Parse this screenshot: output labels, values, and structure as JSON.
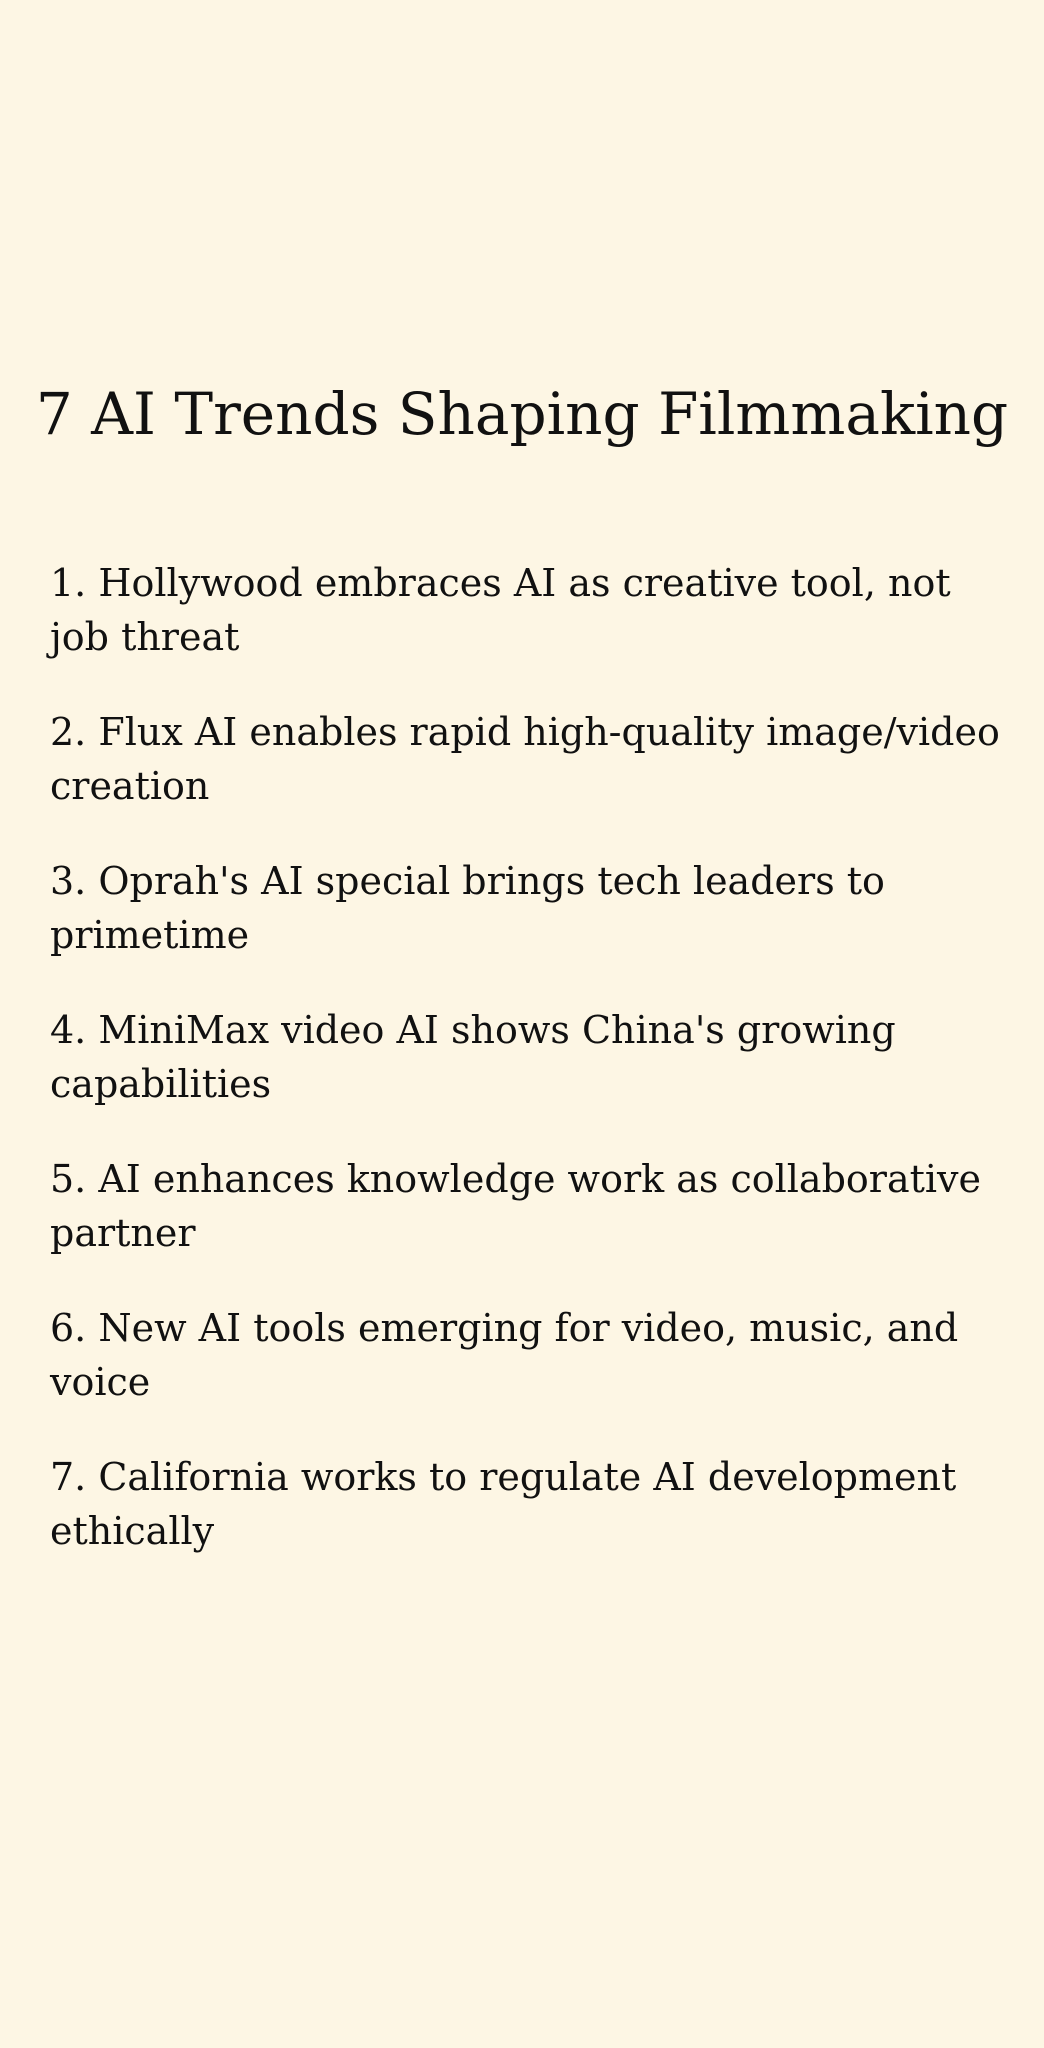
{
  "page": {
    "title": "7 AI Trends Shaping Filmmaking",
    "background": "#fdf6e4",
    "text_color": "#111111"
  },
  "trends": [
    {
      "text": "1. Hollywood embraces AI as creative tool, not job threat"
    },
    {
      "text": "2. Flux AI enables rapid high-quality image/video creation"
    },
    {
      "text": "3. Oprah's AI special brings tech leaders to primetime"
    },
    {
      "text": "4. MiniMax video AI shows China's growing capabilities"
    },
    {
      "text": "5. AI enhances knowledge work as collaborative partner"
    },
    {
      "text": "6. New AI tools emerging for video, music, and voice"
    },
    {
      "text": "7. California works to regulate AI development ethically"
    }
  ]
}
